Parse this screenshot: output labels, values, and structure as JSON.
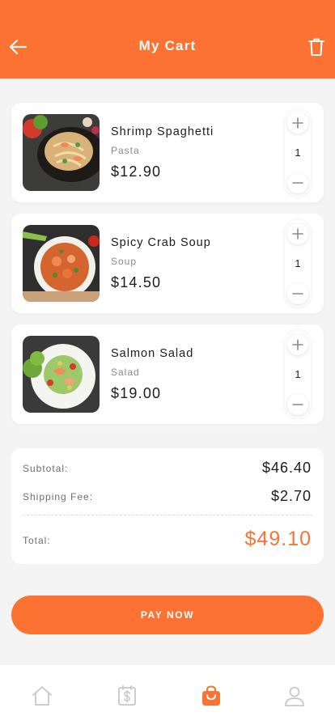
{
  "header": {
    "title": "My Cart",
    "back_icon": "arrow-left-icon",
    "trash_icon": "trash-icon",
    "bg_color": "#fb7233"
  },
  "cart": {
    "items": [
      {
        "name": "Shrimp Spaghetti",
        "category": "Pasta",
        "price": "$12.90",
        "quantity": "1",
        "image": "shrimp-spaghetti-photo"
      },
      {
        "name": "Spicy Crab Soup",
        "category": "Soup",
        "price": "$14.50",
        "quantity": "1",
        "image": "spicy-crab-soup-photo"
      },
      {
        "name": "Salmon Salad",
        "category": "Salad",
        "price": "$19.00",
        "quantity": "1",
        "image": "salmon-salad-photo"
      }
    ]
  },
  "summary": {
    "subtotal_label": "Subtotal:",
    "subtotal_value": "$46.40",
    "shipping_label": "Shipping Fee:",
    "shipping_value": "$2.70",
    "total_label": "Total:",
    "total_value": "$49.10"
  },
  "actions": {
    "pay_label": "PAY NOW"
  },
  "nav": {
    "items": [
      {
        "icon": "home-icon",
        "active": false
      },
      {
        "icon": "receipt-icon",
        "active": false
      },
      {
        "icon": "shopping-bag-icon",
        "active": true
      },
      {
        "icon": "user-icon",
        "active": false
      }
    ],
    "active_color": "#fb7233",
    "inactive_color": "#c8c8c8"
  }
}
